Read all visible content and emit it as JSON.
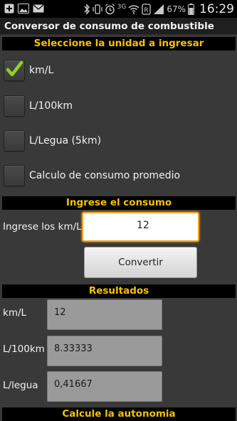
{
  "status_bar": {
    "battery_percent": "67%",
    "time": "16:29",
    "network_label": "3G",
    "icons": [
      "plus-notification-icon",
      "image-notification-icon",
      "mail-icon",
      "bluetooth-icon",
      "vibrate-icon",
      "alarm-icon",
      "signal-3g-icon",
      "wifi-icon",
      "sync-icon",
      "signal-bars-icon",
      "battery-icon"
    ]
  },
  "app": {
    "title": "Conversor de consumo de combustible"
  },
  "unit_section": {
    "header": "Seleccione la unidad a ingresar",
    "options": [
      {
        "label": "km/L",
        "checked": true
      },
      {
        "label": "L/100km",
        "checked": false
      },
      {
        "label": "L/Legua (5km)",
        "checked": false
      },
      {
        "label": "Calculo de consumo promedio",
        "checked": false
      }
    ]
  },
  "input_section": {
    "header": "Ingrese el consumo",
    "label": "Ingrese los km/L",
    "value": "12",
    "button_label": "Convertir"
  },
  "results_section": {
    "header": "Resultados",
    "rows": [
      {
        "label": "km/L",
        "value": "12"
      },
      {
        "label": "L/100km",
        "value": "8.33333"
      },
      {
        "label": "L/legua",
        "value": "0,41667"
      }
    ]
  },
  "autonomy_section": {
    "header": "Calcule la autonomia"
  },
  "colors": {
    "section_header_text": "#f6c200",
    "background": "#393939",
    "input_focus_border": "#f2a11f",
    "checkmark": "#8ed31f"
  }
}
